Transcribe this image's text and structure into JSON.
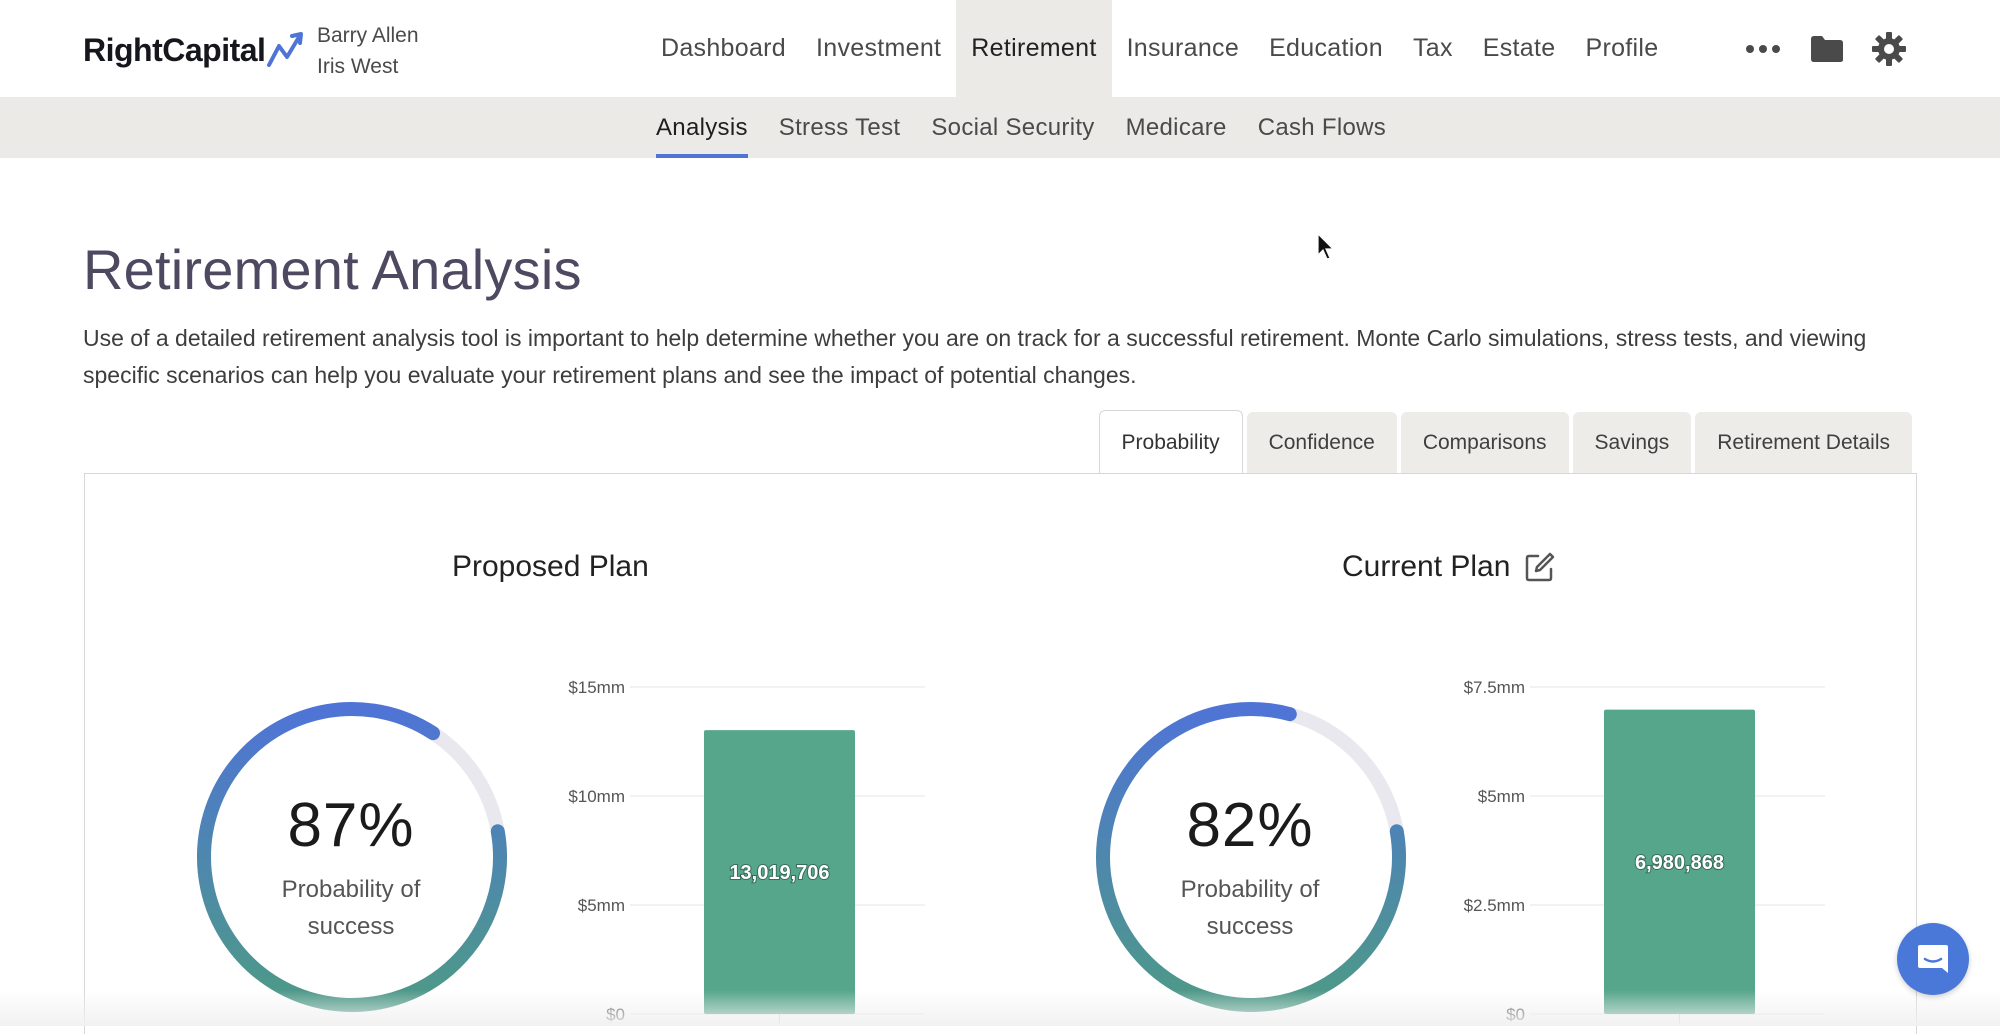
{
  "brand": {
    "logo_text": "RightCapital"
  },
  "clients": [
    "Barry Allen",
    "Iris West"
  ],
  "main_nav": [
    {
      "label": "Dashboard"
    },
    {
      "label": "Investment"
    },
    {
      "label": "Retirement",
      "active": true
    },
    {
      "label": "Insurance"
    },
    {
      "label": "Education"
    },
    {
      "label": "Tax"
    },
    {
      "label": "Estate"
    },
    {
      "label": "Profile"
    }
  ],
  "nav_icons": {
    "more": "•••",
    "folder": "folder-icon",
    "settings": "gear-icon"
  },
  "sub_nav": [
    {
      "label": "Analysis",
      "active": true
    },
    {
      "label": "Stress Test"
    },
    {
      "label": "Social Security"
    },
    {
      "label": "Medicare"
    },
    {
      "label": "Cash Flows"
    }
  ],
  "page": {
    "title": "Retirement Analysis",
    "description": "Use of a detailed retirement analysis tool is important to help determine whether you are on track for a successful retirement. Monte Carlo simulations, stress tests, and viewing specific scenarios can help you evaluate your retirement plans and see the impact of potential changes."
  },
  "tabs": [
    {
      "label": "Probability",
      "active": true
    },
    {
      "label": "Confidence"
    },
    {
      "label": "Comparisons"
    },
    {
      "label": "Savings"
    },
    {
      "label": "Retirement Details"
    }
  ],
  "colors": {
    "accent_blue": "#4f74d6",
    "gauge_teal": "#4d9a86",
    "gauge_track": "#e8e8ee",
    "bar_green": "#55a68a",
    "nav_bg": "#eceae6"
  },
  "proposed": {
    "title": "Proposed Plan",
    "percent": "87%",
    "label_line1": "Probability of",
    "label_line2": "success"
  },
  "current": {
    "title": "Current Plan",
    "percent": "82%",
    "label_line1": "Probability of",
    "label_line2": "success"
  },
  "chart_data": [
    {
      "type": "bar",
      "title": "",
      "categories": [
        ""
      ],
      "values": [
        13019706
      ],
      "value_label": "13,019,706",
      "ylim": [
        0,
        15000000
      ],
      "yticks": [
        0,
        5000000,
        10000000,
        15000000
      ],
      "ytick_labels": [
        "$0",
        "$5mm",
        "$10mm",
        "$15mm"
      ],
      "grid": true,
      "bar_color": "#55a68a"
    },
    {
      "type": "bar",
      "title": "",
      "categories": [
        ""
      ],
      "values": [
        6980868
      ],
      "value_label": "6,980,868",
      "ylim": [
        0,
        7500000
      ],
      "yticks": [
        0,
        2500000,
        5000000,
        7500000
      ],
      "ytick_labels": [
        "$0",
        "$2.5mm",
        "$5mm",
        "$7.5mm"
      ],
      "grid": true,
      "bar_color": "#55a68a"
    }
  ],
  "gauges": [
    {
      "name": "proposed",
      "fraction": 0.87
    },
    {
      "name": "current",
      "fraction": 0.82
    }
  ]
}
